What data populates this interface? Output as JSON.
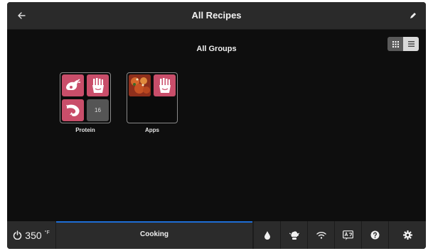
{
  "header": {
    "title": "All Recipes"
  },
  "main": {
    "section_title": "All Groups"
  },
  "groups": [
    {
      "label": "Protein",
      "count": "16"
    },
    {
      "label": "Apps"
    }
  ],
  "footer": {
    "temperature": "350",
    "unit": "°F",
    "status": "Cooking",
    "progress": 1.0
  },
  "colors": {
    "accent": "#1e6ed6",
    "tile": "#c94e6a",
    "background": "#0e0e0e",
    "bar": "#2b2b2b"
  },
  "icons": [
    "back-arrow-icon",
    "pencil-icon",
    "grid-view-icon",
    "list-view-icon",
    "power-icon",
    "water-drop-icon",
    "chef-icon",
    "wifi-icon",
    "language-icon",
    "help-icon",
    "gear-icon"
  ]
}
